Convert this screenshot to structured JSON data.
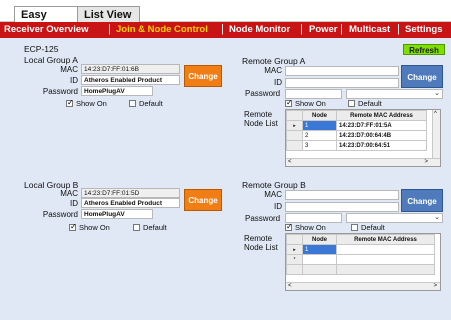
{
  "tabs": {
    "active": "Easy View",
    "inactive": "List View"
  },
  "menu": {
    "items": [
      "Receiver Overview",
      "Join & Node Control",
      "Node Monitor",
      "Power",
      "Multicast",
      "Settings"
    ],
    "active_index": 1
  },
  "device": {
    "name": "ECP-125",
    "refresh_label": "Refresh"
  },
  "local_a": {
    "title": "Local Group A",
    "mac_label": "MAC",
    "mac": "14:23:D7:FF:01:6B",
    "id_label": "ID",
    "id": "Atheros Enabled Product",
    "password_label": "Password",
    "password": "HomePlugAV",
    "change_label": "Change",
    "show_on_label": "Show On",
    "default_label": "Default"
  },
  "local_b": {
    "title": "Local Group B",
    "mac_label": "MAC",
    "mac": "14:23:D7:FF:01:5D",
    "id_label": "ID",
    "id": "Atheros Enabled Product",
    "password_label": "Password",
    "password": "HomePlugAV",
    "change_label": "Change",
    "show_on_label": "Show On",
    "default_label": "Default"
  },
  "remote_a": {
    "title": "Remote Group A",
    "mac_label": "MAC",
    "id_label": "ID",
    "password_label": "Password",
    "change_label": "Change",
    "show_on_label": "Show On",
    "default_label": "Default",
    "node_list_label_1": "Remote",
    "node_list_label_2": "Node List",
    "columns": [
      "Node",
      "Remote MAC Address"
    ],
    "rows": [
      {
        "node": "1",
        "mac": "14:23:D7:FF:01:5A"
      },
      {
        "node": "2",
        "mac": "14:23:D7:00:64:4B"
      },
      {
        "node": "3",
        "mac": "14:23:D7:00:64:51"
      }
    ]
  },
  "remote_b": {
    "title": "Remote Group B",
    "mac_label": "MAC",
    "id_label": "ID",
    "password_label": "Password",
    "change_label": "Change",
    "show_on_label": "Show On",
    "default_label": "Default",
    "node_list_label_1": "Remote",
    "node_list_label_2": "Node List",
    "columns": [
      "Node",
      "Remote MAC Address"
    ],
    "rows": [
      {
        "node": "1",
        "mac": ""
      }
    ],
    "new_row_marker": "*"
  },
  "icons": {
    "row_pointer": "▸",
    "scroll_left": "<",
    "scroll_right": ">",
    "scroll_up": "^",
    "dropdown": "⌄"
  }
}
